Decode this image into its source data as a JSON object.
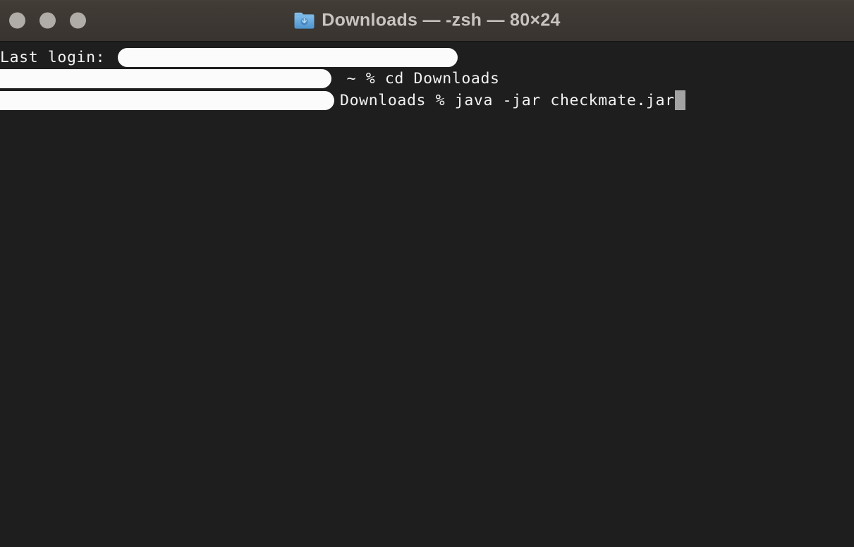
{
  "window": {
    "title": "Downloads — -zsh — 80×24",
    "icon": "downloads-folder-icon",
    "traffic_lights": [
      {
        "name": "close",
        "label": "Close",
        "color": "#b0aca7"
      },
      {
        "name": "minimize",
        "label": "Minimize",
        "color": "#b0aca7"
      },
      {
        "name": "zoom",
        "label": "Zoom",
        "color": "#b0aca7"
      }
    ],
    "titlebar_color": "#3d3733",
    "background_color": "#1e1e1e",
    "text_color": "#f2f2f2",
    "cursor_color": "#a3a3a3"
  },
  "terminal": {
    "columns": "80",
    "rows": "24",
    "shell": "-zsh",
    "directory": "Downloads",
    "lines": [
      {
        "id": "line-last-login",
        "prefix": "Last login:",
        "redacted": true,
        "suffix": ""
      },
      {
        "id": "line-cd-downloads",
        "prefix": "",
        "redacted": true,
        "suffix": " ~ % cd Downloads"
      },
      {
        "id": "line-java-jar",
        "prefix": "",
        "redacted": true,
        "suffix": "Downloads % java -jar checkmate.jar"
      }
    ],
    "cursor": "block"
  }
}
